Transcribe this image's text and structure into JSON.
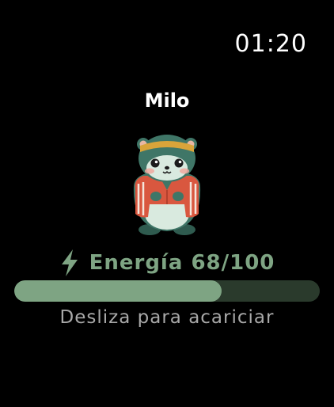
{
  "status_bar": {
    "time": "01:20"
  },
  "pet": {
    "name": "Milo",
    "avatar_icon": "hamster-character-icon"
  },
  "energy": {
    "icon": "lightning-bolt-icon",
    "label": "Energía 68/100",
    "value": 68,
    "max": 100,
    "fraction": 0.68
  },
  "hint": {
    "text": "Desliza para acariciar"
  },
  "colors": {
    "background": "#000000",
    "accent": "#7ea483",
    "bar_track": "#2a3a2c",
    "hint_text": "#a8a8a8",
    "text": "#ffffff"
  }
}
